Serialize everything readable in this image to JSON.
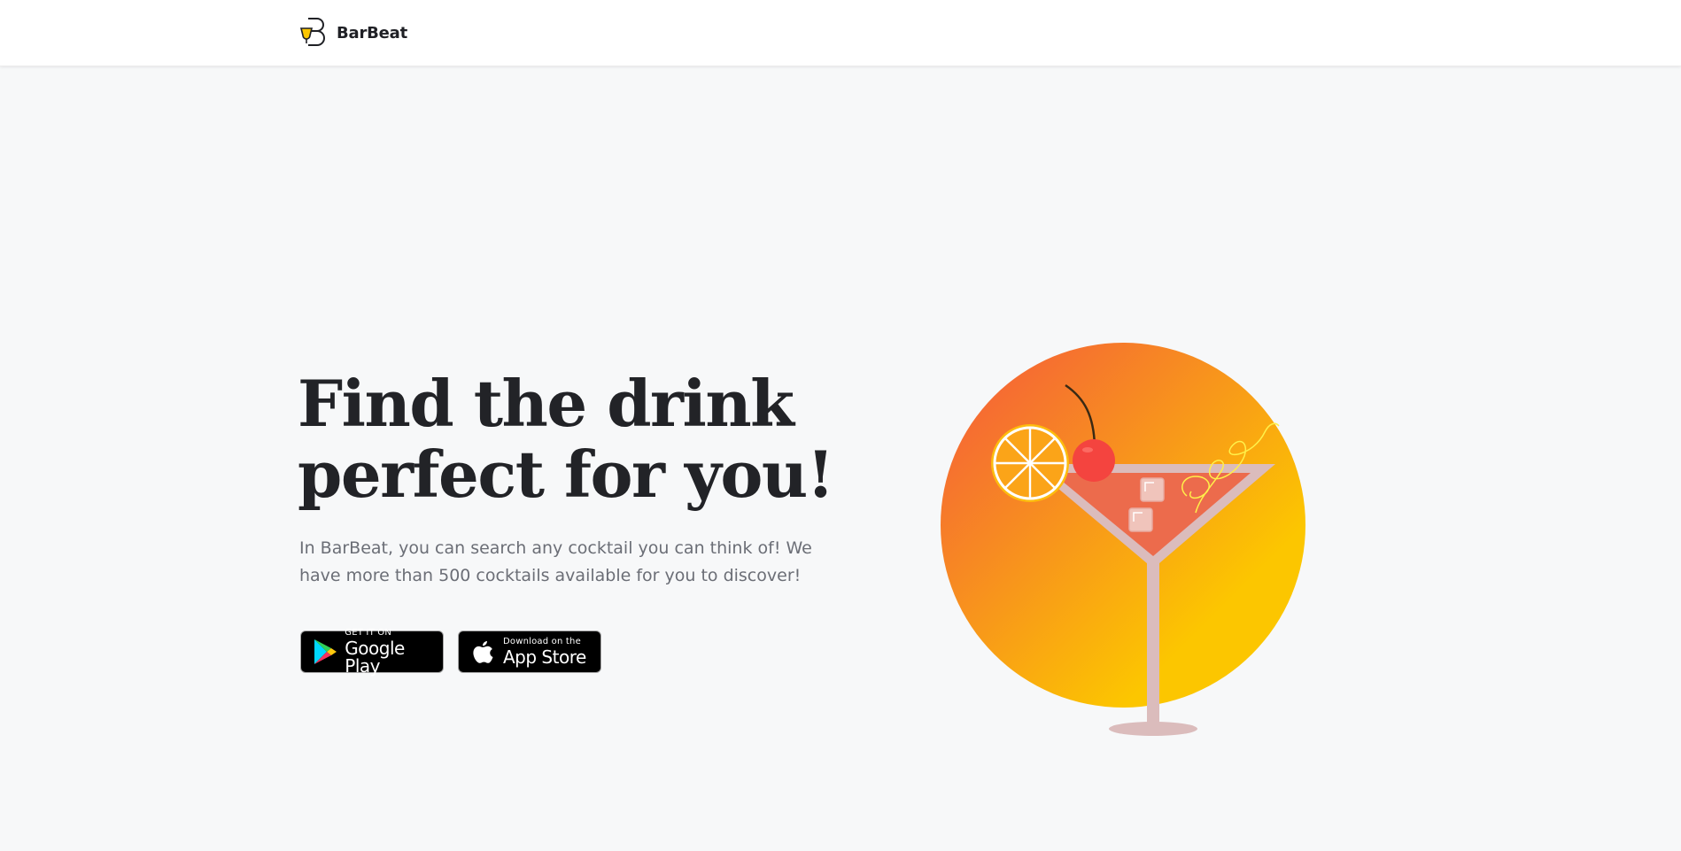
{
  "header": {
    "brand_name": "BarBeat",
    "logo_icon": "barbeat-logo-icon"
  },
  "hero": {
    "title_line1": "Find the drink",
    "title_line2": "perfect for you!",
    "description": "In BarBeat, you can search any cocktail you can think of! We have more than 500 cocktails available for you to discover!"
  },
  "stores": {
    "google": {
      "small": "GET IT ON",
      "big": "Google Play",
      "icon": "google-play-icon"
    },
    "apple": {
      "small": "Download on the",
      "big": "App Store",
      "icon": "apple-icon"
    }
  },
  "colors": {
    "accent_yellow": "#fcc600",
    "accent_orange": "#f76a3c",
    "text_dark": "#222327",
    "text_muted": "#6b6e76",
    "background": "#f7f8f9"
  }
}
